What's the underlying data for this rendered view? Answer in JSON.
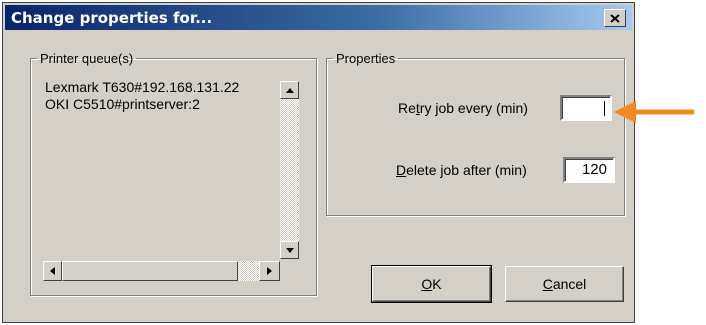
{
  "window": {
    "title": "Change properties for..."
  },
  "queue_group": {
    "legend": "Printer queue(s)",
    "items": [
      "Lexmark T630#192.168.131.22",
      "OKI C5510#printserver:2"
    ]
  },
  "props_group": {
    "legend": "Properties",
    "retry": {
      "label_pre": "Re",
      "label_key": "t",
      "label_post": "ry job every (min)",
      "value": ""
    },
    "delete": {
      "label_key": "D",
      "label_post": "elete job after (min)",
      "value": "120"
    }
  },
  "buttons": {
    "ok": {
      "key": "O",
      "rest": "K"
    },
    "cancel": {
      "key": "C",
      "rest": "ancel"
    }
  },
  "colors": {
    "arrow": "#f08a24",
    "titlebar_start": "#0a246a",
    "titlebar_end": "#a6caf0"
  },
  "icons": [
    "close-icon",
    "scroll-up-arrow-icon",
    "scroll-down-arrow-icon",
    "scroll-left-arrow-icon",
    "scroll-right-arrow-icon",
    "annotation-arrow-icon"
  ]
}
